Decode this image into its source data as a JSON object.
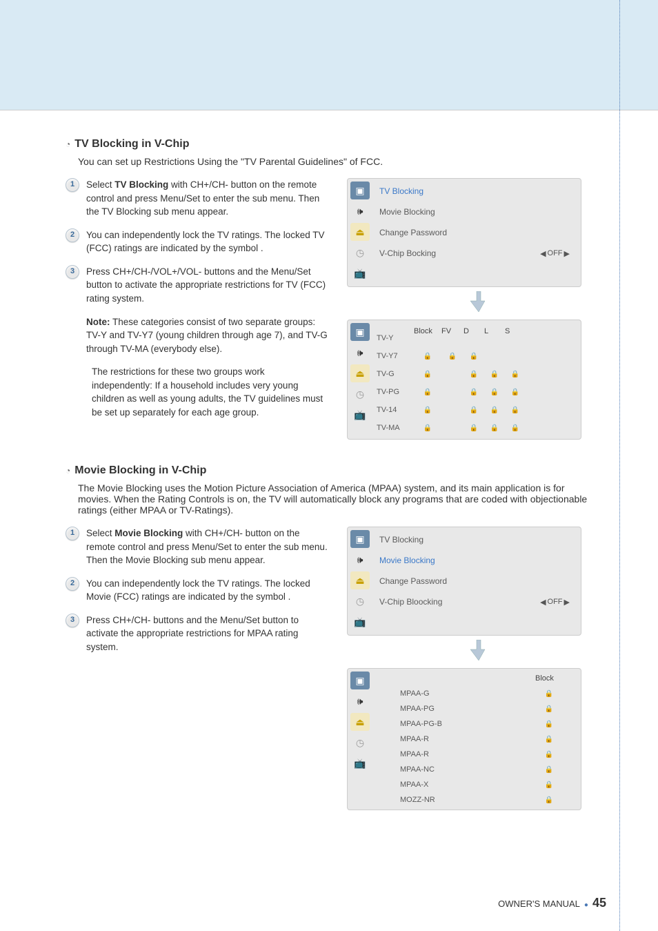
{
  "footer": {
    "label": "OWNER'S MANUAL",
    "page": "45"
  },
  "section1": {
    "title": "TV Blocking in V-Chip",
    "intro": "You can set up Restrictions Using the \"TV Parental Guidelines\" of FCC.",
    "steps": {
      "s1a": "Select ",
      "s1b": "TV Blocking",
      "s1c": " with CH+/CH- button on the remote control and press Menu/Set to enter the sub menu. Then the TV Blocking sub menu appear.",
      "s2": "You can independently lock the TV ratings. The locked TV (FCC) ratings are indicated by the symbol   .",
      "s3": "Press CH+/CH-/VOL+/VOL- buttons and the Menu/Set button to activate the appropriate restrictions for TV (FCC) rating system."
    },
    "note": {
      "label": "Note:",
      "p1": " These categories consist of two separate groups: TV-Y and TV-Y7 (young children through age 7), and TV-G through TV-MA (everybody else).",
      "p2": "The restrictions for these two groups work independently: If a household includes very young children as well as young adults, the TV guidelines must be set up separately for each age group."
    },
    "osd": {
      "r1": "TV Blocking",
      "r2": "Movie Blocking",
      "r3": "Change Password",
      "r4": "V-Chip Bocking",
      "off": "OFF"
    },
    "grid": {
      "h_block": "Block",
      "h_fv": "FV",
      "h_d": "D",
      "h_l": "L",
      "h_s": "S",
      "r1": "TV-Y",
      "r2": "TV-Y7",
      "r3": "TV-G",
      "r4": "TV-PG",
      "r5": "TV-14",
      "r6": "TV-MA"
    }
  },
  "section2": {
    "title": "Movie Blocking in V-Chip",
    "intro": "The Movie Blocking uses the Motion Picture Association of America (MPAA) system, and its main application is for movies. When the Rating Controls is on, the TV will automatically block any programs that are coded with objectionable ratings (either MPAA or TV-Ratings).",
    "steps": {
      "s1a": "Select ",
      "s1b": "Movie Blocking",
      "s1c": " with CH+/CH- button on the remote control and press Menu/Set to enter the sub menu. Then the Movie Blocking sub menu appear.",
      "s2": "You can independently lock the TV ratings. The locked Movie (FCC) ratings are indicated by the symbol   .",
      "s3": "Press CH+/CH- buttons and the Menu/Set button to activate the appropriate restrictions for MPAA rating system."
    },
    "osd": {
      "r1": "TV Blocking",
      "r2": "Movie Blocking",
      "r3": "Change Password",
      "r4": "V-Chip Bloocking",
      "off": "OFF"
    },
    "grid": {
      "h_block": "Block",
      "r1": "MPAA-G",
      "r2": "MPAA-PG",
      "r3": "MPAA-PG-B",
      "r4": "MPAA-R",
      "r5": "MPAA-R",
      "r6": "MPAA-NC",
      "r7": "MPAA-X",
      "r8": "MOZZ-NR"
    }
  },
  "icons": {
    "lock": "🔒"
  }
}
